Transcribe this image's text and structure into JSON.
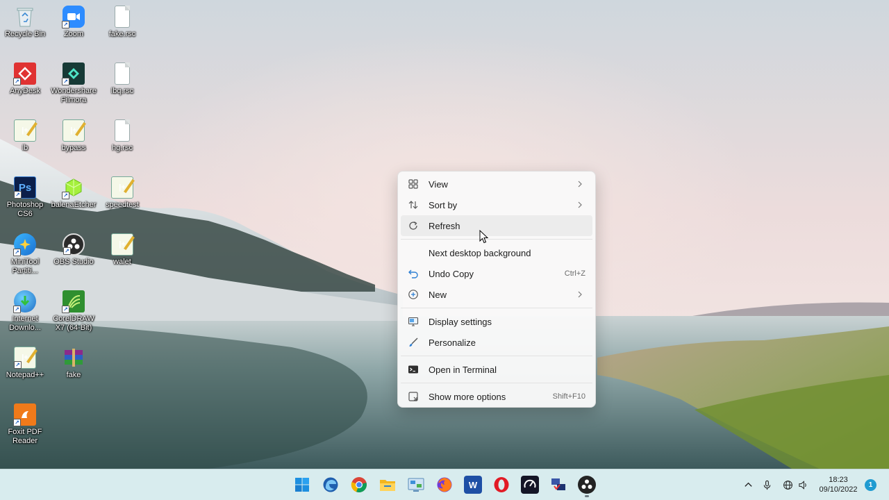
{
  "desktop": {
    "icons": [
      {
        "label": "Recycle Bin"
      },
      {
        "label": "Zoom"
      },
      {
        "label": "fake.rsc"
      },
      {
        "label": "AnyDesk"
      },
      {
        "label": "Wondershare Filmora"
      },
      {
        "label": "lbq.rsc"
      },
      {
        "label": "lb"
      },
      {
        "label": "bypass"
      },
      {
        "label": "hg.rsc"
      },
      {
        "label": "Photoshop CS6"
      },
      {
        "label": "balenaEtcher"
      },
      {
        "label": "speedtest"
      },
      {
        "label": "MiniTool Partiti..."
      },
      {
        "label": "OBS Studio"
      },
      {
        "label": "walet"
      },
      {
        "label": "Internet Downlo..."
      },
      {
        "label": "CorelDRAW X7 (64-Bit)"
      },
      {
        "label": "Notepad++"
      },
      {
        "label": "fake"
      },
      {
        "label": "Foxit PDF Reader"
      }
    ]
  },
  "context_menu": {
    "items": [
      {
        "label": "View",
        "icon": "grid-view-icon",
        "submenu": true
      },
      {
        "label": "Sort by",
        "icon": "sort-icon",
        "submenu": true
      },
      {
        "label": "Refresh",
        "icon": "refresh-icon",
        "hovered": true
      },
      {
        "label": "Next desktop background"
      },
      {
        "label": "Undo Copy",
        "icon": "undo-icon",
        "shortcut": "Ctrl+Z"
      },
      {
        "label": "New",
        "icon": "plus-circle-icon",
        "submenu": true
      },
      {
        "label": "Display settings",
        "icon": "display-icon"
      },
      {
        "label": "Personalize",
        "icon": "brush-icon"
      },
      {
        "label": "Open in Terminal",
        "icon": "terminal-icon"
      },
      {
        "label": "Show more options",
        "icon": "more-options-icon",
        "shortcut": "Shift+F10"
      }
    ]
  },
  "taskbar": {
    "apps": [
      {
        "name": "start-icon"
      },
      {
        "name": "edge-icon"
      },
      {
        "name": "chrome-icon"
      },
      {
        "name": "file-explorer-icon"
      },
      {
        "name": "control-panel-icon"
      },
      {
        "name": "firefox-icon"
      },
      {
        "name": "word-icon"
      },
      {
        "name": "opera-icon"
      },
      {
        "name": "speedtest-icon"
      },
      {
        "name": "network-tool-icon"
      },
      {
        "name": "obs-icon"
      }
    ],
    "clock": {
      "time": "18:23",
      "date": "09/10/2022"
    },
    "notification_count": "1"
  },
  "colors": {
    "taskbar_bg": "#d8ecee",
    "menu_bg": "#f9f9f9",
    "hover_bg": "#ececec",
    "accent": "#1f9bd1"
  }
}
